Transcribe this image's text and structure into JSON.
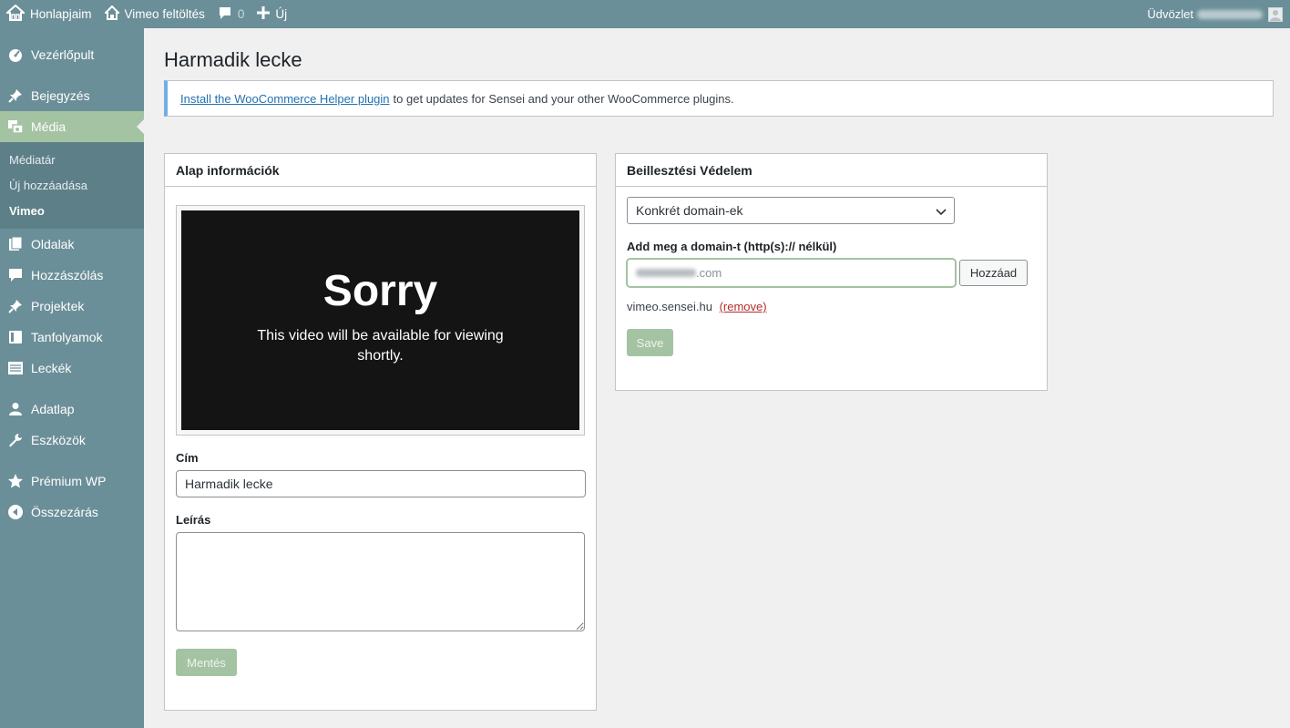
{
  "adminbar": {
    "site_name": "Honlapjaim",
    "site_link": "Vimeo feltöltés",
    "comments_count": "0",
    "new_label": "Új",
    "greeting": "Üdvözlet"
  },
  "sidebar": {
    "items": [
      {
        "label": "Vezérlőpult",
        "icon": "dashboard-icon"
      },
      {
        "label": "Bejegyzés",
        "icon": "pin-icon"
      },
      {
        "label": "Média",
        "icon": "media-icon"
      },
      {
        "label": "Oldalak",
        "icon": "pages-icon"
      },
      {
        "label": "Hozzászólás",
        "icon": "comment-icon"
      },
      {
        "label": "Projektek",
        "icon": "pin-icon"
      },
      {
        "label": "Tanfolyamok",
        "icon": "book-icon"
      },
      {
        "label": "Leckék",
        "icon": "list-icon"
      },
      {
        "label": "Adatlap",
        "icon": "user-icon"
      },
      {
        "label": "Eszközök",
        "icon": "wrench-icon"
      },
      {
        "label": "Prémium WP",
        "icon": "star-icon"
      },
      {
        "label": "Összezárás",
        "icon": "collapse-icon"
      }
    ],
    "media_submenu": [
      "Médiatár",
      "Új hozzáadása",
      "Vimeo"
    ]
  },
  "page": {
    "title": "Harmadik lecke",
    "notice": {
      "link_text": "Install the WooCommerce Helper plugin",
      "text": "to get updates for Sensei and your other WooCommerce plugins."
    }
  },
  "basic_box": {
    "title": "Alap információk",
    "video_heading": "Sorry",
    "video_message": "This video will be available for viewing shortly.",
    "title_label": "Cím",
    "title_value": "Harmadik lecke",
    "description_label": "Leírás",
    "description_value": "",
    "save_label": "Mentés"
  },
  "embed_box": {
    "title": "Beillesztési Védelem",
    "select_value": "Konkrét domain-ek",
    "domain_label": "Add meg a domain-t (http(s):// nélkül)",
    "domain_input_suffix": ".com",
    "add_label": "Hozzáad",
    "domain_entry": "vimeo.sensei.hu",
    "remove_label": "(remove)",
    "save_label": "Save"
  },
  "colors": {
    "sidebar_bg": "#6b8f98",
    "accent_green": "#a4c3a2",
    "link_blue": "#2271b1",
    "remove_red": "#b32d2e"
  }
}
